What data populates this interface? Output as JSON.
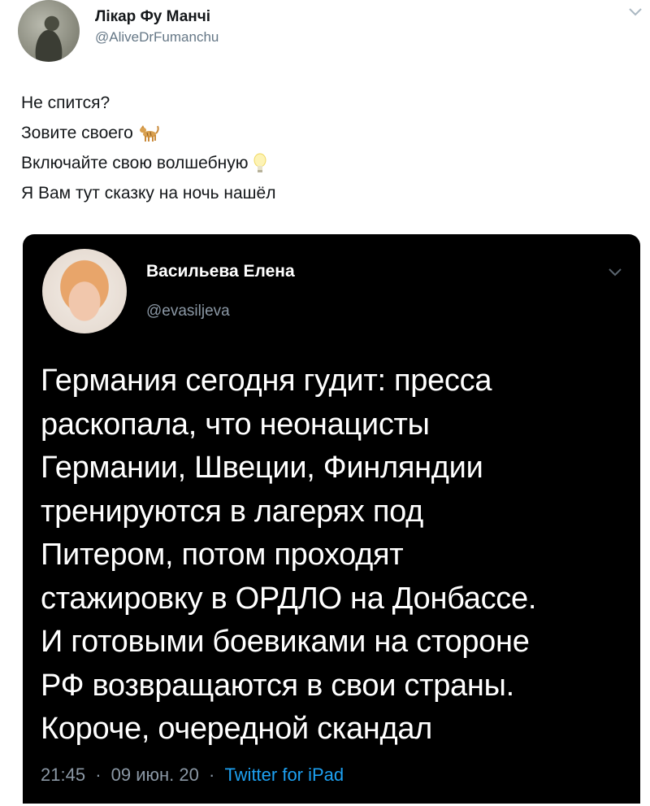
{
  "outer_tweet": {
    "author_name": "Лікар Фу Манчі",
    "author_handle": "@AliveDrFumanchu",
    "lines": [
      "Не спится?",
      "Зовите своего",
      "Включайте свою волшебную",
      "Я Вам тут сказку на ночь нашёл"
    ],
    "emojis": [
      "cat-icon",
      "lightbulb-icon"
    ]
  },
  "quoted_tweet": {
    "author_name": "Васильева Елена",
    "author_handle": "@evasiljeva",
    "body_lines": [
      "Германия сегодня гудит: пресса",
      "раскопала, что неонацисты",
      "Германии, Швеции, Финляндии",
      "тренируются в лагерях под",
      "Питером, потом проходят",
      "стажировку в ОРДЛО на Донбассе.",
      "И готовыми боевиками на стороне",
      "РФ возвращаются в свои страны.",
      "Короче, очередной скандал"
    ],
    "time": "21:45",
    "date": "09 июн. 20",
    "separator": "·",
    "source": "Twitter for iPad"
  },
  "colors": {
    "text_dark": "#14171a",
    "handle_gray": "#657786",
    "card_bg": "#000000",
    "meta_gray": "#8b98a5",
    "link_blue": "#1da1f2"
  }
}
